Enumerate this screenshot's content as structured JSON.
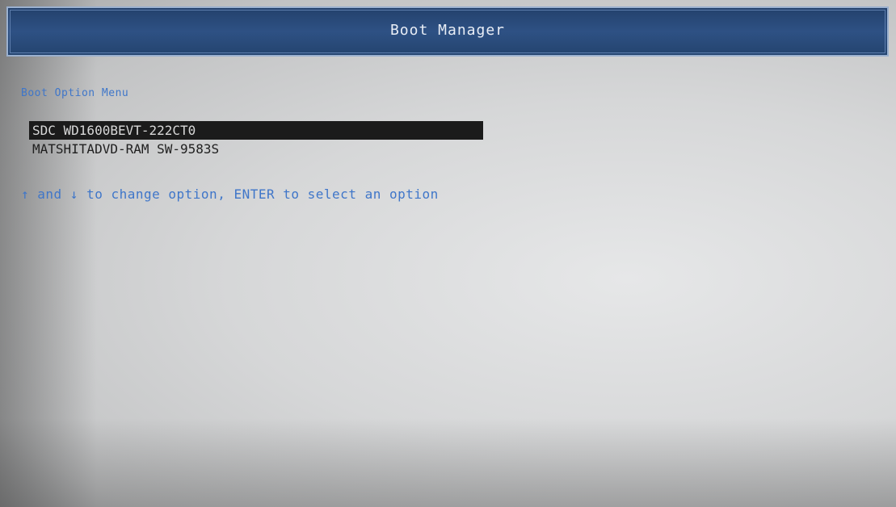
{
  "window": {
    "title": "Boot Manager"
  },
  "menu": {
    "heading": "Boot Option Menu",
    "items": [
      {
        "label": "SDC WD1600BEVT-222CT0",
        "selected": true
      },
      {
        "label": "MATSHITADVD-RAM SW-9583S",
        "selected": false
      }
    ]
  },
  "hint": "↑ and ↓ to change option, ENTER to select an option",
  "colors": {
    "title_bar": "#2e5184",
    "accent_text": "#3f76c9",
    "selection_bg": "#1b1b1b",
    "screen_bg": "#d6d7d8"
  }
}
